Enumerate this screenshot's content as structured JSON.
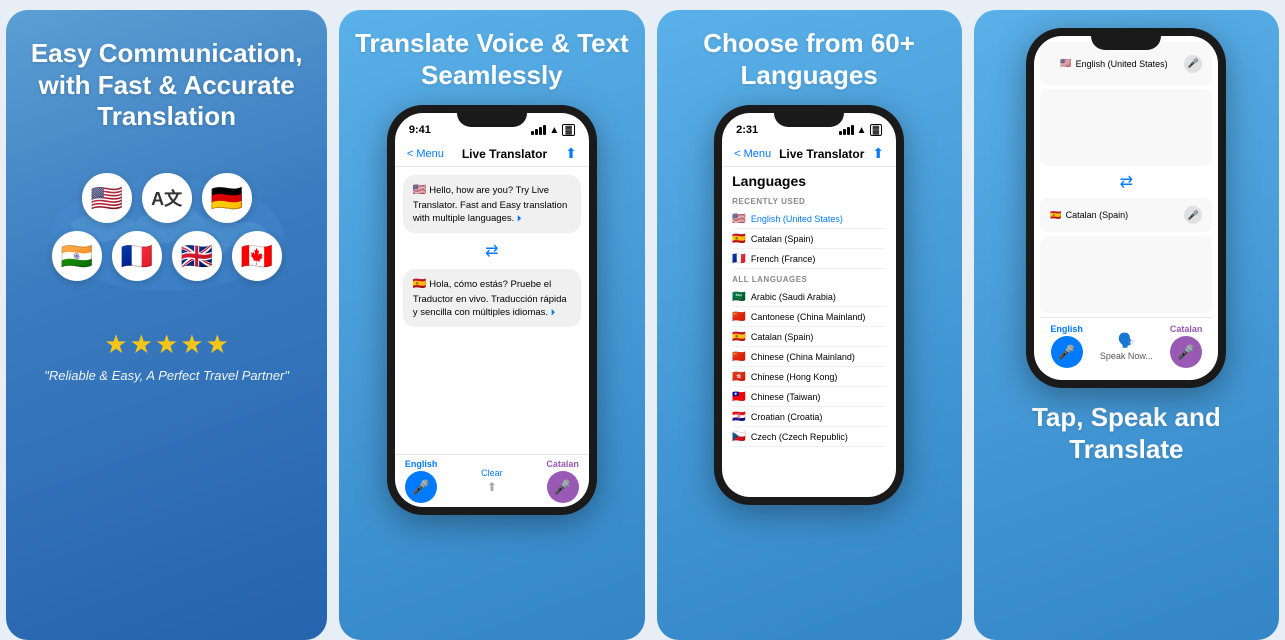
{
  "panel1": {
    "headline": "Easy Communication, with Fast & Accurate Translation",
    "flags": [
      {
        "emoji": "🇺🇸",
        "label": "us-flag"
      },
      {
        "emoji": "A文",
        "label": "translate-icon"
      },
      {
        "emoji": "🇩🇪",
        "label": "de-flag"
      },
      {
        "emoji": "🇮🇳",
        "label": "in-flag"
      },
      {
        "emoji": "🇫🇷",
        "label": "fr-flag"
      },
      {
        "emoji": "🇬🇧",
        "label": "gb-flag"
      },
      {
        "emoji": "🇨🇦",
        "label": "ca-flag"
      }
    ],
    "stars": "★★★★★",
    "review": "\"Reliable & Easy, A Perfect Travel Partner\""
  },
  "panel2": {
    "headline": "Translate Voice & Text Seamlessly",
    "phone": {
      "time": "9:41",
      "nav_back": "< Menu",
      "nav_title": "Live Translator",
      "bubble1_flag": "🇺🇸",
      "bubble1_text": "Hello, how are you? Try Live Translator. Fast and Easy translation with multiple languages.",
      "bubble2_flag": "🇪🇸",
      "bubble2_text": "Hola, cómo estás? Pruebe el Traductor en vivo. Traducción rápida y sencilla con múltiples idiomas.",
      "lang_left": "English",
      "lang_right": "Catalan",
      "clear_label": "Clear"
    }
  },
  "panel3": {
    "headline": "Choose from 60+ Languages",
    "phone": {
      "time": "2:31",
      "nav_back": "< Menu",
      "nav_title": "Live Translator",
      "list_title": "Languages",
      "recently_used_label": "RECENTLY USED",
      "all_languages_label": "ALL LANGUAGES",
      "recently_used": [
        {
          "flag": "🇺🇸",
          "name": "English (United States)",
          "highlighted": true
        },
        {
          "flag": "🇪🇸",
          "name": "Catalan (Spain)",
          "highlighted": false
        },
        {
          "flag": "🇫🇷",
          "name": "French (France)",
          "highlighted": false
        }
      ],
      "all_languages": [
        {
          "flag": "🇸🇦",
          "name": "Arabic (Saudi Arabia)"
        },
        {
          "flag": "🇨🇳",
          "name": "Cantonese (China Mainland)"
        },
        {
          "flag": "🇪🇸",
          "name": "Catalan (Spain)"
        },
        {
          "flag": "🇨🇳",
          "name": "Chinese (China Mainland)"
        },
        {
          "flag": "🇭🇰",
          "name": "Chinese (Hong Kong)"
        },
        {
          "flag": "🇹🇼",
          "name": "Chinese (Taiwan)"
        },
        {
          "flag": "🇭🇷",
          "name": "Croatian (Croatia)"
        },
        {
          "flag": "🇨🇿",
          "name": "Czech (Czech Republic)"
        }
      ]
    }
  },
  "panel4": {
    "headline": "Tap, Speak and Translate",
    "phone": {
      "lang_top": "English (United States)",
      "lang_bottom": "Catalan (Spain)",
      "lang_left": "English",
      "lang_right": "Catalan",
      "speak_now": "Speak Now..."
    }
  }
}
